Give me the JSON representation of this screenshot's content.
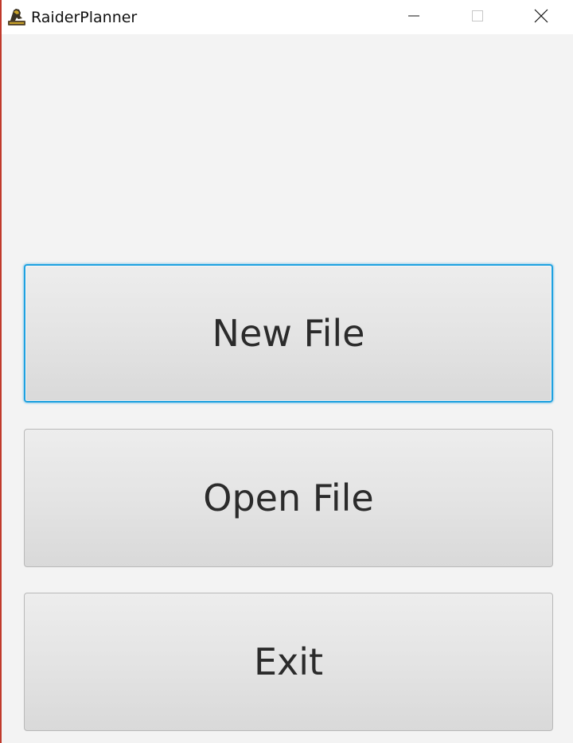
{
  "window": {
    "title": "RaiderPlanner",
    "app_icon": "raider-mascot-icon",
    "controls": {
      "minimize_icon": "minimize-icon",
      "maximize_icon": "maximize-icon",
      "close_icon": "close-icon"
    }
  },
  "menu": {
    "new_file_label": "New File",
    "open_file_label": "Open File",
    "exit_label": "Exit"
  },
  "colors": {
    "focus_ring": "#1ea1e0",
    "background": "#f3f3f3",
    "button_text": "#2b2b2b"
  }
}
